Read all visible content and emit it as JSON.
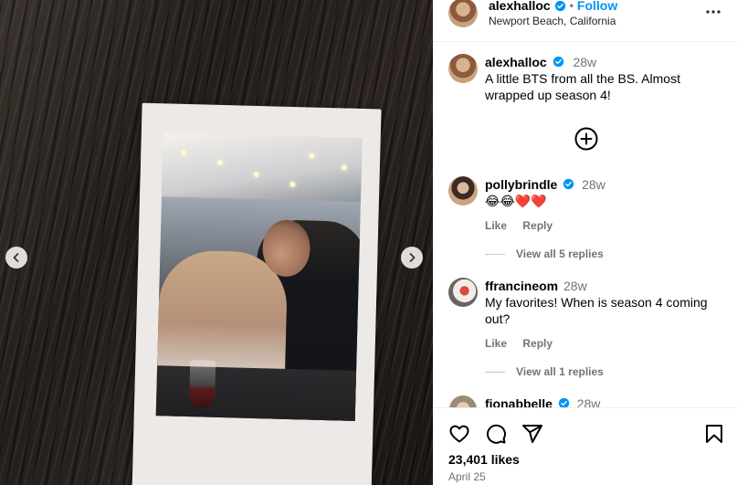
{
  "post": {
    "username": "alexhalloc",
    "separator": "•",
    "follow_label": "Follow",
    "location": "Newport Beach, California",
    "caption_time": "28w",
    "caption": "A little BTS from all the BS. Almost wrapped up season 4!"
  },
  "comments": [
    {
      "username": "pollybrindle",
      "verified": true,
      "time": "28w",
      "text": "😂😂❤️❤️",
      "like_label": "Like",
      "reply_label": "Reply",
      "view_replies": "View all 5 replies"
    },
    {
      "username": "ffrancineom",
      "verified": false,
      "time": "28w",
      "text": "My favorites! When is season 4 coming out?",
      "like_label": "Like",
      "reply_label": "Reply",
      "view_replies": "View all 1 replies"
    },
    {
      "username": "fionabbelle",
      "verified": true,
      "time": "28w",
      "text": ""
    }
  ],
  "footer": {
    "likes": "23,401 likes",
    "date": "April 25"
  },
  "icons": {
    "verified": "verified-badge-icon",
    "more": "more-options-icon",
    "add": "add-circle-icon",
    "like": "heart-icon",
    "comment": "comment-icon",
    "share": "share-icon",
    "save": "bookmark-icon",
    "prev": "chevron-left-icon",
    "next": "chevron-right-icon"
  },
  "colors": {
    "accent": "#0095f6",
    "muted": "#737373"
  }
}
